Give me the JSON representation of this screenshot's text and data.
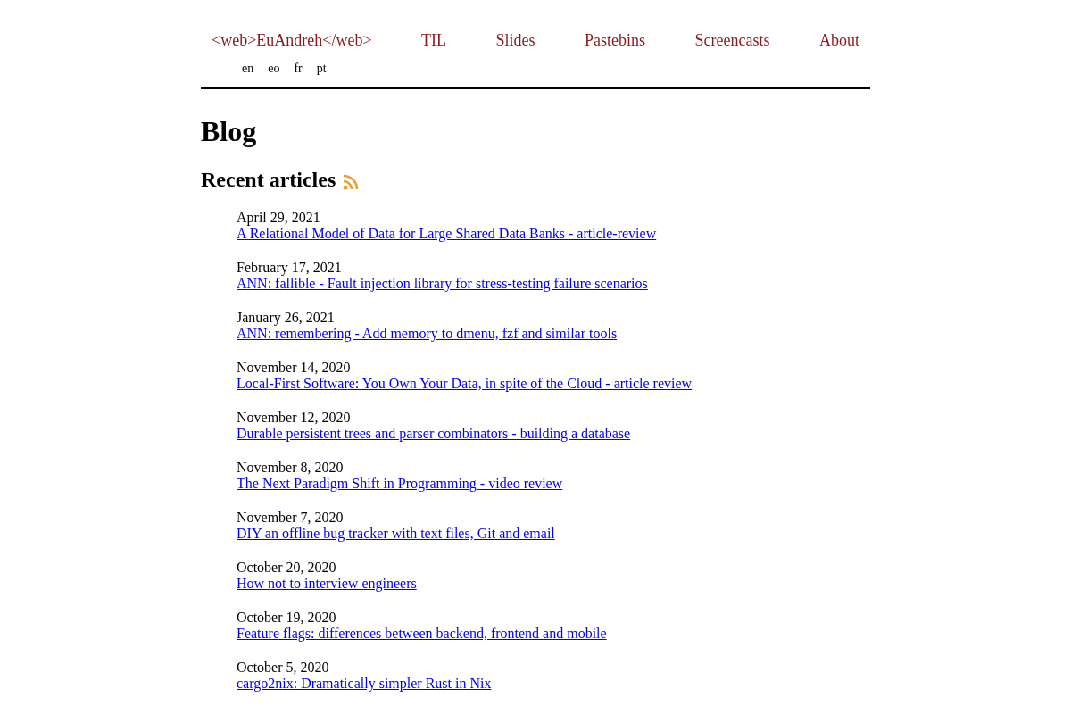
{
  "header": {
    "site_title": "<web>EuAndreh</web>",
    "nav": [
      {
        "label": "TIL"
      },
      {
        "label": "Slides"
      },
      {
        "label": "Pastebins"
      },
      {
        "label": "Screencasts"
      },
      {
        "label": "About"
      }
    ],
    "languages": [
      {
        "label": "en"
      },
      {
        "label": "eo"
      },
      {
        "label": "fr"
      },
      {
        "label": "pt"
      }
    ]
  },
  "page_title": "Blog",
  "section": {
    "title": "Recent articles",
    "articles": [
      {
        "date": "April 29, 2021",
        "title": "A Relational Model of Data for Large Shared Data Banks - article-review"
      },
      {
        "date": "February 17, 2021",
        "title": "ANN: fallible - Fault injection library for stress-testing failure scenarios"
      },
      {
        "date": "January 26, 2021",
        "title": "ANN: remembering - Add memory to dmenu, fzf and similar tools"
      },
      {
        "date": "November 14, 2020",
        "title": "Local-First Software: You Own Your Data, in spite of the Cloud - article review"
      },
      {
        "date": "November 12, 2020",
        "title": "Durable persistent trees and parser combinators - building a database"
      },
      {
        "date": "November 8, 2020",
        "title": "The Next Paradigm Shift in Programming - video review"
      },
      {
        "date": "November 7, 2020",
        "title": "DIY an offline bug tracker with text files, Git and email"
      },
      {
        "date": "October 20, 2020",
        "title": "How not to interview engineers"
      },
      {
        "date": "October 19, 2020",
        "title": "Feature flags: differences between backend, frontend and mobile"
      },
      {
        "date": "October 5, 2020",
        "title": "cargo2nix: Dramatically simpler Rust in Nix"
      }
    ]
  }
}
